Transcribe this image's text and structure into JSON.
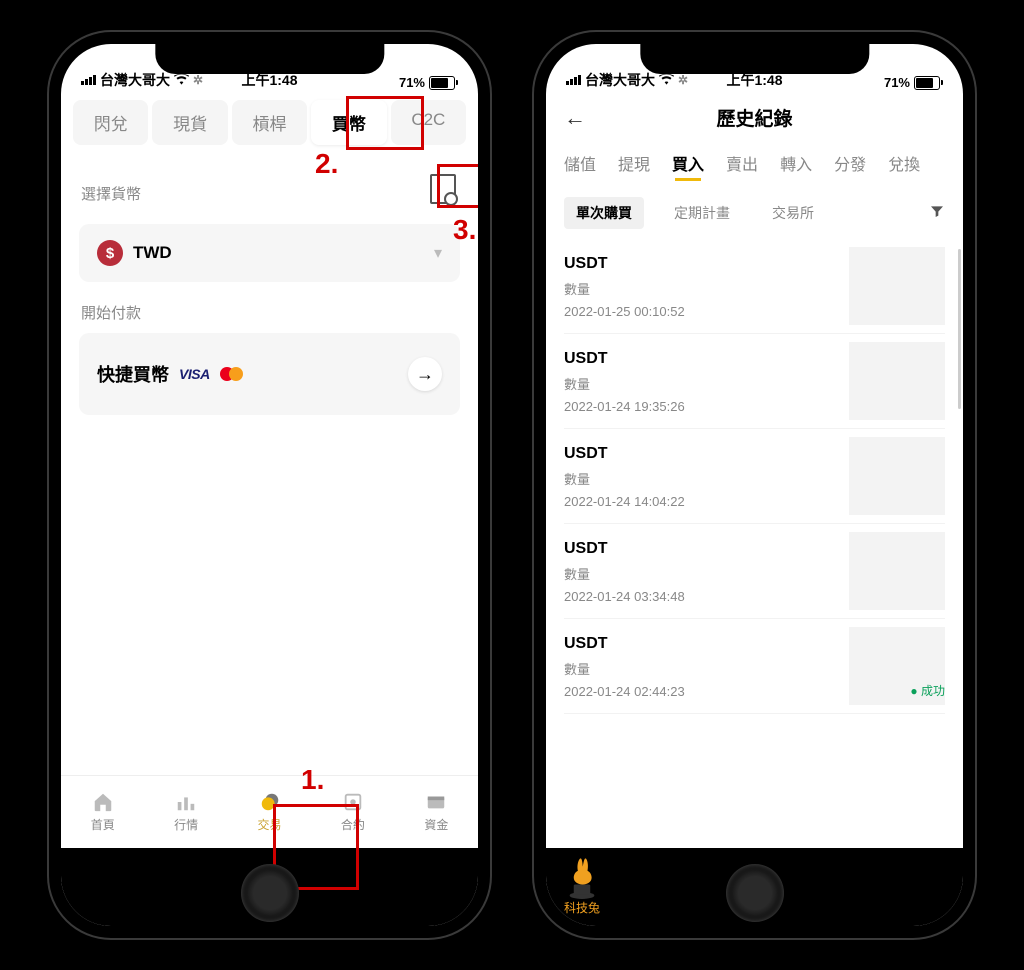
{
  "status": {
    "carrier": "台灣大哥大",
    "time": "上午1:48",
    "battery_pct": "71%"
  },
  "phone1": {
    "tabs": [
      "閃兌",
      "現貨",
      "槓桿",
      "買幣",
      "C2C"
    ],
    "active_tab_index": 3,
    "select_currency_label": "選擇貨幣",
    "currency_code": "TWD",
    "start_payment_label": "開始付款",
    "quick_buy_label": "快捷買幣",
    "nav": [
      {
        "label": "首頁"
      },
      {
        "label": "行情"
      },
      {
        "label": "交易"
      },
      {
        "label": "合約"
      },
      {
        "label": "資金"
      }
    ],
    "active_nav_index": 2,
    "annotations": {
      "n1": "1.",
      "n2": "2.",
      "n3": "3."
    }
  },
  "phone2": {
    "title": "歷史紀錄",
    "tabs": [
      "儲值",
      "提現",
      "買入",
      "賣出",
      "轉入",
      "分發",
      "兌換"
    ],
    "active_tab_index": 2,
    "filters": [
      "單次購買",
      "定期計畫",
      "交易所"
    ],
    "active_filter_index": 0,
    "qty_label": "數量",
    "success_label": "成功",
    "records": [
      {
        "asset": "USDT",
        "ts": "2022-01-25 00:10:52"
      },
      {
        "asset": "USDT",
        "ts": "2022-01-24 19:35:26"
      },
      {
        "asset": "USDT",
        "ts": "2022-01-24 14:04:22"
      },
      {
        "asset": "USDT",
        "ts": "2022-01-24 03:34:48"
      },
      {
        "asset": "USDT",
        "ts": "2022-01-24 02:44:23"
      }
    ],
    "watermark": "科技兔"
  }
}
